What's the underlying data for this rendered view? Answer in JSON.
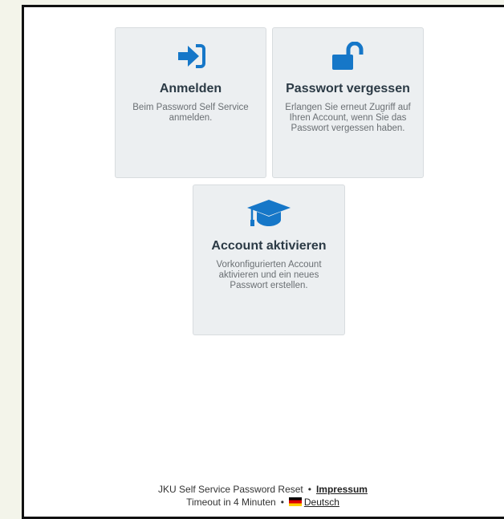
{
  "tiles": [
    {
      "title": "Anmelden",
      "description": "Beim Password Self Service anmelden.",
      "icon": "sign-in-icon"
    },
    {
      "title": "Passwort vergessen",
      "description": "Erlangen Sie erneut Zugriff auf Ihren Account, wenn Sie das Passwort vergessen haben.",
      "icon": "unlock-icon"
    },
    {
      "title": "Account aktivieren",
      "description": "Vorkonfigurierten Account aktivieren und ein neues Passwort erstellen.",
      "icon": "graduation-cap-icon"
    }
  ],
  "footer": {
    "app_name": "JKU Self Service Password Reset",
    "separator": "•",
    "impressum": "Impressum",
    "timeout": "Timeout in 4 Minuten",
    "language": "Deutsch",
    "language_flag": "german-flag-icon"
  },
  "colors": {
    "accent": "#1677c8",
    "tile_bg": "#eceff1",
    "page_bg": "#f3f4ea"
  }
}
